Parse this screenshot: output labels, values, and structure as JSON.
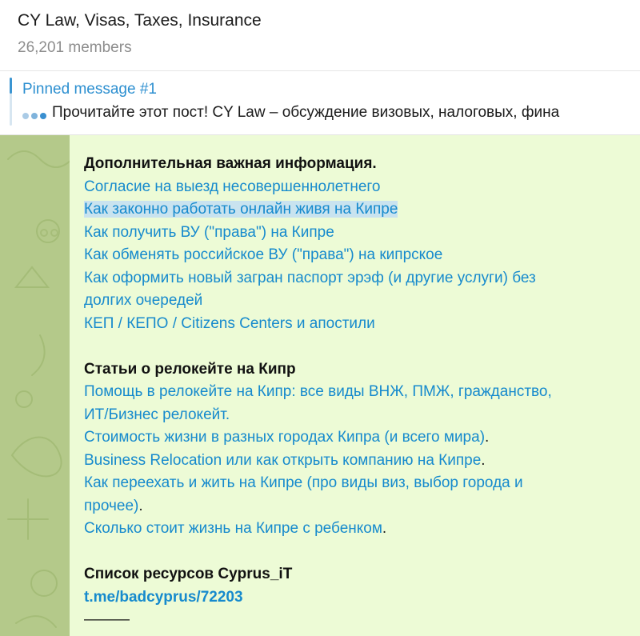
{
  "header": {
    "title": "CY Law, Visas, Taxes, Insurance",
    "members": "26,201 members"
  },
  "pinned": {
    "title": "Pinned message #1",
    "text": "Прочитайте этот пост!  CY Law – обсуждение визовых, налоговых, фина"
  },
  "message": {
    "section1": {
      "heading": "Дополнительная важная информация.",
      "links": [
        "Согласие на выезд несовершеннолетнего",
        "Как законно работать онлайн живя на Кипре",
        "Как получить ВУ (\"права\") на Кипре",
        "Как обменять российское ВУ (\"права\") на кипрское",
        "Как оформить новый загран паспорт эрэф (и другие услуги) без",
        "долгих очередей",
        "КЕП / КЕПО / Citizens Centers и апостили"
      ]
    },
    "section2": {
      "heading": "Статьи о релокейте на Кипр",
      "link1_line1": "Помощь в релокейте на Кипр: все виды ВНЖ, ПМЖ, гражданство,",
      "link1_line2": "ИТ/Бизнес релокейт.",
      "link2": "Стоимость жизни в разных городах Кипра (и всего мира)",
      "link2_tail": ".",
      "link3": "Business Relocation или как открыть компанию на Кипре",
      "link3_tail": ".",
      "link4_line1": "Как переехать и жить на Кипре (про виды виз, выбор города и",
      "link4_line2": "прочее)",
      "link4_tail": ".",
      "link5": "Сколько стоит жизнь на Кипре с ребенком",
      "link5_tail": "."
    },
    "section3": {
      "heading": "Список ресурсов Cyprus_iT",
      "link": "t.me/badcyprus/72203",
      "divider": "———"
    }
  },
  "colors": {
    "link": "#168acd",
    "pin_accent": "#2c8fd0",
    "bubble_bg": "#edfbd6",
    "wallpaper": "#b4c98a",
    "highlight": "#c9e3ef"
  }
}
